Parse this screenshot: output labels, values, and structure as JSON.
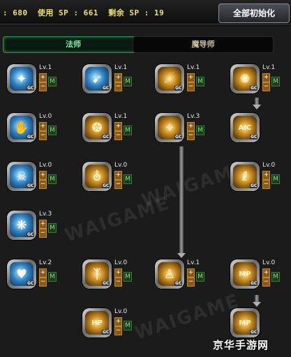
{
  "topbar": {
    "sp_text": ": 680  使用 SP : 661  剩余 SP : 19",
    "reset_label": "全部初始化"
  },
  "tabs": [
    {
      "label": "法师",
      "active": true
    },
    {
      "label": "魔导师",
      "active": false
    }
  ],
  "watermark": "WAIGAME",
  "brand": "京华手游网",
  "skill_controls": {
    "plus": "+",
    "minus": "−",
    "master": "M",
    "gc": "GC"
  },
  "skills": [
    {
      "level": "Lv.1",
      "style": "blue",
      "glyph": "✦"
    },
    {
      "level": "Lv.1",
      "style": "blue",
      "glyph": "➹"
    },
    {
      "level": "Lv.1",
      "style": "gold",
      "glyph": "☄"
    },
    {
      "level": "Lv.1",
      "style": "gold",
      "glyph": "✺"
    },
    {
      "level": "Lv.0",
      "style": "blue",
      "glyph": "✋"
    },
    {
      "level": "Lv.1",
      "style": "gold",
      "glyph": "✪"
    },
    {
      "level": "Lv.3",
      "style": "gold",
      "glyph": "✧"
    },
    {
      "level": "",
      "style": "gold",
      "glyph": "AIC"
    },
    {
      "level": "Lv.0",
      "style": "blue",
      "glyph": "☠"
    },
    {
      "level": "Lv.0",
      "style": "gold",
      "glyph": "♁"
    },
    {
      "level": "Lv.0",
      "style": "gold",
      "glyph": "ℓ"
    },
    {
      "level": "Lv.3",
      "style": "blue",
      "glyph": "❋"
    },
    {
      "level": "Lv.2",
      "style": "blue",
      "glyph": "♥"
    },
    {
      "level": "Lv.0",
      "style": "gold",
      "glyph": "ᛉ"
    },
    {
      "level": "Lv.1",
      "style": "gold",
      "glyph": "♙"
    },
    {
      "level": "Lv.0",
      "style": "gold",
      "glyph": "MP"
    },
    {
      "level": "Lv.0",
      "style": "gold",
      "glyph": "HP"
    },
    {
      "level": "",
      "style": "gold",
      "glyph": "MP"
    }
  ]
}
